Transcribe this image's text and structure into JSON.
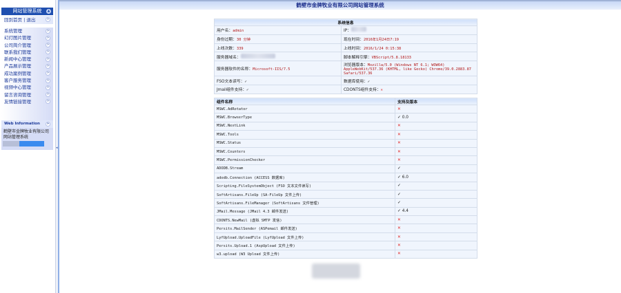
{
  "header": {
    "title": "鹤壁市金牌牧业有限公司网站管理系统"
  },
  "sidebar": {
    "title": "网站管理系统",
    "home": "回到首页",
    "sep": "|",
    "logout": "退出",
    "items": [
      "系统管理",
      "幻灯图片管理",
      "公司简介管理",
      "联系我们管理",
      "新闻中心管理",
      "产品展示管理",
      "成功案例管理",
      "客户服务管理",
      "视频中心管理",
      "留言咨询管理",
      "友情链接管理"
    ],
    "info_title": "Web Information",
    "info_text": "鹤壁市金牌牧业有限公司网站管理系统"
  },
  "sysinfo": {
    "title": "系统信息",
    "rows": [
      [
        {
          "label": "用户名：",
          "value": "admin"
        },
        {
          "label": "IP：",
          "value": ""
        }
      ],
      [
        {
          "label": "身份过期：",
          "value": "30 分钟"
        },
        {
          "label": "现在时间：",
          "value": "2016年1月24日7:19"
        }
      ],
      [
        {
          "label": "上线次数：",
          "value": "339"
        },
        {
          "label": "上线时间：",
          "value": "2016/1/24 0:15:38"
        }
      ],
      [
        {
          "label": "服务器域名：",
          "value": ""
        },
        {
          "label": "脚本解释引擎：",
          "value": "VBScript/5.8.18133"
        }
      ],
      [
        {
          "label": "服务器软件的名称：",
          "value": "Microsoft-IIS/7.5"
        },
        {
          "label": "浏览器版本：",
          "value": "Mozilla/5.0 (Windows NT 6.1; WOW64) AppleWebKit/537.36 (KHTML, like Gecko) Chrome/39.0.2883.87 Safari/537.36"
        }
      ],
      [
        {
          "label": "FSO文本读写：",
          "value": "✓"
        },
        {
          "label": "数据库使用：",
          "value": "✓"
        }
      ],
      [
        {
          "label": "Jmail组件支持：",
          "value": "✓"
        },
        {
          "label": "CDONTS组件支持：",
          "value": "✕"
        }
      ]
    ]
  },
  "components": {
    "col_name": "组件名称",
    "col_support": "支持及版本",
    "rows": [
      {
        "name": "MSWC.AdRotator",
        "support": "✕"
      },
      {
        "name": "MSWC.BrowserType",
        "support": "✓ 0.0"
      },
      {
        "name": "MSWC.NextLink",
        "support": "✕"
      },
      {
        "name": "MSWC.Tools",
        "support": "✕"
      },
      {
        "name": "MSWC.Status",
        "support": "✕"
      },
      {
        "name": "MSWC.Counters",
        "support": "✕"
      },
      {
        "name": "MSWC.PermissionChecker",
        "support": "✕"
      },
      {
        "name": "ADODB.Stream",
        "support": "✓"
      },
      {
        "name": "adodb.Connection (ACCESS 数据库)",
        "support": "✓ 6.0"
      },
      {
        "name": "Scripting.FileSystemObject (FSO 文本文件读写)",
        "support": "✓"
      },
      {
        "name": "SoftArtisans.FileUp (SA-FileUp 文件上传)",
        "support": "✓"
      },
      {
        "name": "SoftArtisans.FileManager (SoftArtisans 文件管理)",
        "support": "✓"
      },
      {
        "name": "JMail.Message (JMail 4.3 邮件发送)",
        "support": "✓ 4.4"
      },
      {
        "name": "CDONTS.NewMail (虚拟 SMTP 发信)",
        "support": "✕"
      },
      {
        "name": "Persits.MailSender (ASPemail 邮件发送)",
        "support": "✕"
      },
      {
        "name": "LyfUpload.UploadFile (LyfUpload 文件上传)",
        "support": "✕"
      },
      {
        "name": "Persits.Upload.1 (AspUpload 文件上传)",
        "support": "✕"
      },
      {
        "name": "w3.upload (W3 Upload 文件上传)",
        "support": "✕"
      }
    ]
  }
}
